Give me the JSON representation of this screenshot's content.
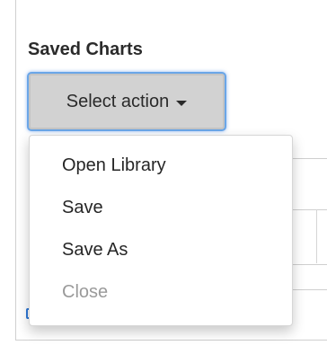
{
  "panel": {
    "title": "Saved Charts"
  },
  "action_button": {
    "label": "Select action"
  },
  "menu": {
    "items": [
      {
        "label": "Open Library",
        "enabled": true
      },
      {
        "label": "Save",
        "enabled": true
      },
      {
        "label": "Save As",
        "enabled": true
      },
      {
        "label": "Close",
        "enabled": false
      }
    ]
  },
  "colors": {
    "focus_ring": "#6aa6e8",
    "button_bg": "#d2d2d2",
    "disabled_text": "#9a9a9a"
  }
}
